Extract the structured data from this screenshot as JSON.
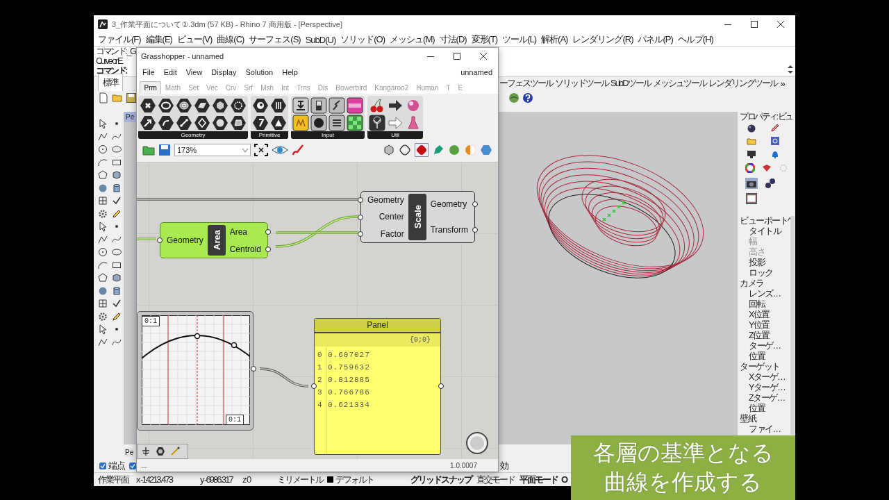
{
  "rhino": {
    "title": "3_作業平面について②.3dm (57 KB) - Rhino 7 商用版 - [Perspective]",
    "menu": [
      "ファイル(F)",
      "編集(E)",
      "ビュー(V)",
      "曲線(C)",
      "サーフェス(S)",
      "SubD(U)",
      "ソリッド(O)",
      "メッシュ(M)",
      "寸法(D)",
      "変形(T)",
      "ツール(L)",
      "解析(A)",
      "レンダリング(R)",
      "パネル(P)",
      "ヘルプ(H)"
    ],
    "command_lines": [
      {
        "text": "コマンド: _G",
        "bold": false
      },
      {
        "text": "Curve or E",
        "bold": false
      },
      {
        "text": "コマンド:",
        "bold": true
      }
    ],
    "toolbar_tabs": [
      {
        "label": "標準",
        "selected": true
      },
      {
        "label": "ーフェスツール",
        "selected": false
      },
      {
        "label": "ソリッドツール",
        "selected": false
      },
      {
        "label": "SubDツール",
        "selected": false
      },
      {
        "label": "メッシュツール",
        "selected": false
      },
      {
        "label": "レンダリングツール",
        "selected": false
      }
    ],
    "more_tabs": "»",
    "viewport_label": "Pe",
    "viewport_tab": "Pe",
    "properties": {
      "title": "プロパティ: ビュ",
      "tree": [
        {
          "label": "ビューポート^",
          "children": [
            {
              "label": "タイトル",
              "disabled": false
            },
            {
              "label": "幅",
              "disabled": true
            },
            {
              "label": "高さ",
              "disabled": true
            },
            {
              "label": "投影",
              "disabled": false
            },
            {
              "label": "ロック",
              "disabled": false
            }
          ]
        },
        {
          "label": "カメラ",
          "children": [
            {
              "label": "レンズ…",
              "disabled": false
            },
            {
              "label": "回転",
              "disabled": false
            },
            {
              "label": "X位置",
              "disabled": false
            },
            {
              "label": "Y位置",
              "disabled": false
            },
            {
              "label": "Z位置",
              "disabled": false
            },
            {
              "label": "ターゲ…",
              "disabled": false
            },
            {
              "label": "位置",
              "disabled": false
            }
          ]
        },
        {
          "label": "ターゲット",
          "children": [
            {
              "label": "Xターゲ…",
              "disabled": false
            },
            {
              "label": "Yターゲ…",
              "disabled": false
            },
            {
              "label": "Zターゲ…",
              "disabled": false
            },
            {
              "label": "位置",
              "disabled": false
            }
          ]
        },
        {
          "label": "壁紙",
          "children": [
            {
              "label": "ファイ…",
              "disabled": false
            }
          ]
        }
      ]
    },
    "osnap": [
      {
        "label": "端点",
        "checked": true
      },
      {
        "checked": true
      }
    ],
    "osnap_tail": "効",
    "status": [
      {
        "kind": "text",
        "text": "作業平面"
      },
      {
        "kind": "text",
        "text": "x -14213.473"
      },
      {
        "kind": "text",
        "text": "y -6986.317"
      },
      {
        "kind": "text",
        "text": "z 0"
      },
      {
        "kind": "text",
        "text": "ミリメートル"
      },
      {
        "kind": "layer",
        "text": "デフォルト",
        "color": "#000000"
      },
      {
        "kind": "toggle",
        "text": "グリッドスナップ",
        "on": true
      },
      {
        "kind": "toggle",
        "text": "直交モード",
        "on": false
      },
      {
        "kind": "toggle",
        "text": "平面モード",
        "on": true
      },
      {
        "kind": "toggle",
        "text": "O",
        "on": true
      }
    ]
  },
  "grasshopper": {
    "title": "Grasshopper - unnamed",
    "menu": [
      "File",
      "Edit",
      "View",
      "Display",
      "Solution",
      "Help"
    ],
    "document": "unnamed",
    "tabs": [
      {
        "label": "Prm",
        "selected": true
      },
      {
        "label": "Math",
        "selected": false
      },
      {
        "label": "Set",
        "selected": false
      },
      {
        "label": "Vec",
        "selected": false
      },
      {
        "label": "Crv",
        "selected": false
      },
      {
        "label": "Srf",
        "selected": false
      },
      {
        "label": "Msh",
        "selected": false
      },
      {
        "label": "Int",
        "selected": false
      },
      {
        "label": "Trns",
        "selected": false
      },
      {
        "label": "Dis",
        "selected": false
      },
      {
        "label": "Bowerbird",
        "selected": false
      },
      {
        "label": "Kangaroo2",
        "selected": false
      },
      {
        "label": "Human",
        "selected": false
      },
      {
        "label": "T",
        "selected": false
      },
      {
        "label": "E",
        "selected": false
      }
    ],
    "ribbon_groups": [
      {
        "label": "Geometry"
      },
      {
        "label": "Primitive"
      },
      {
        "label": "Input"
      },
      {
        "label": "Util"
      }
    ],
    "zoom": "173%",
    "nodes": [
      {
        "kind": "component",
        "name": "Area",
        "selected": true,
        "inputs": [
          "Geometry"
        ],
        "outputs": [
          "Area",
          "Centroid"
        ]
      },
      {
        "kind": "component",
        "name": "Scale",
        "selected": false,
        "inputs": [
          "Geometry",
          "Center",
          "Factor"
        ],
        "outputs": [
          "Geometry",
          "Transform"
        ]
      },
      {
        "kind": "graph_mapper",
        "top_label": "0:1",
        "bottom_label": "0:1"
      },
      {
        "kind": "panel",
        "title": "Panel",
        "path": "{0;0}",
        "rows": [
          {
            "index": "0",
            "value": "0.607027"
          },
          {
            "index": "1",
            "value": "0.759632"
          },
          {
            "index": "2",
            "value": "0.812885"
          },
          {
            "index": "3",
            "value": "0.766786"
          },
          {
            "index": "4",
            "value": "0.621334"
          }
        ]
      }
    ],
    "status": "...",
    "version": "1.0.0007"
  },
  "caption": [
    "各層の基準となる",
    "曲線を作成する"
  ]
}
